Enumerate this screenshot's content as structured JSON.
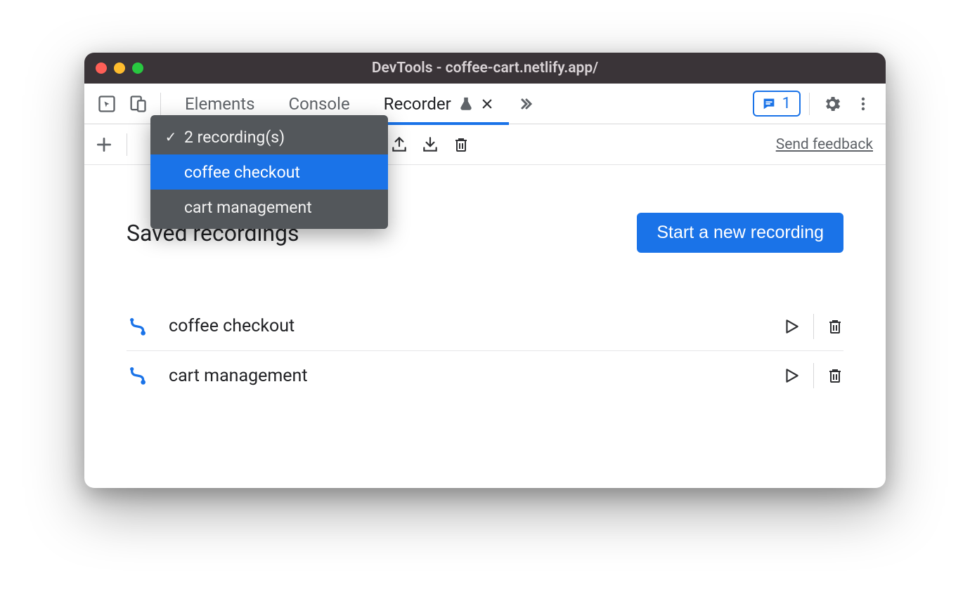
{
  "window": {
    "title": "DevTools - coffee-cart.netlify.app/"
  },
  "tabs": {
    "elements": "Elements",
    "console": "Console",
    "recorder": "Recorder"
  },
  "issues_badge": {
    "count": "1"
  },
  "toolbar": {
    "send_feedback": "Send feedback"
  },
  "dropdown": {
    "summary": "2 recording(s)",
    "items": [
      {
        "label": "coffee checkout",
        "selected": true
      },
      {
        "label": "cart management",
        "selected": false
      }
    ]
  },
  "page": {
    "heading": "Saved recordings",
    "primary_button": "Start a new recording"
  },
  "recordings": [
    {
      "name": "coffee checkout"
    },
    {
      "name": "cart management"
    }
  ]
}
